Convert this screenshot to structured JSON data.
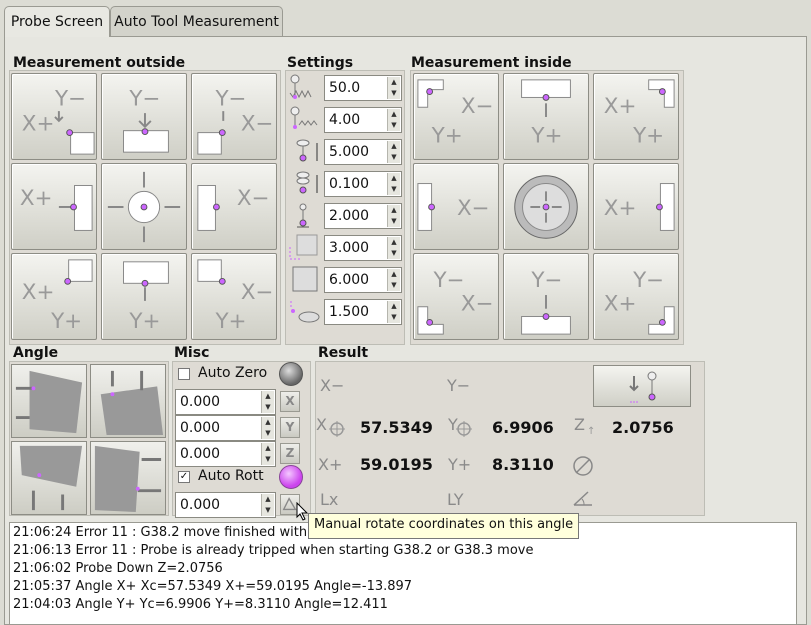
{
  "tabs": [
    "Probe Screen",
    "Auto Tool Measurement"
  ],
  "groups": {
    "outside": "Measurement outside",
    "settings": "Settings",
    "inside": "Measurement inside",
    "angle": "Angle",
    "misc": "Misc",
    "result": "Result"
  },
  "settings": [
    "50.0",
    "4.00",
    "5.000",
    "0.100",
    "2.000",
    "3.000",
    "6.000",
    "1.500"
  ],
  "misc": {
    "auto_zero": "Auto Zero",
    "auto_zero_checked": false,
    "auto_rott": "Auto Rott",
    "auto_rott_checked": true,
    "fields": [
      "0.000",
      "0.000",
      "0.000"
    ],
    "axis_buttons": [
      "X",
      "Y",
      "Z"
    ],
    "angle_field": "0.000"
  },
  "result": {
    "xminus_label": "X−",
    "yminus_label": "Y−",
    "xc_label": "X",
    "xc_value": "57.5349",
    "yc_label": "Y",
    "yc_value": "6.9906",
    "z_label": "Z",
    "z_value": "2.0756",
    "xplus_label": "X+",
    "xplus_value": "59.0195",
    "yplus_label": "Y+",
    "yplus_value": "8.3110",
    "lx_label": "Lx",
    "ly_label": "LY"
  },
  "log": [
    "21:06:24  Error 11 : G38.2 move finished with",
    "21:06:13  Error 11 : Probe is already tripped when starting G38.2 or G38.3 move",
    "21:06:02  Probe Down Z=2.0756",
    "21:05:37  Angle X+  Xc=57.5349 X+=59.0195 Angle=-13.897",
    "21:04:03  Angle Y+  Yc=6.9906 Y+=8.3110 Angle=12.411"
  ],
  "tooltip": "Manual rotate coordinates on this angle",
  "colors": {
    "probe_dot": "#cc66ff",
    "accent_led": "#cc44ee",
    "gray_led": "#777777"
  }
}
